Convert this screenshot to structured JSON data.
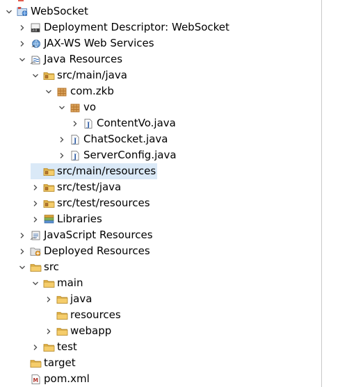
{
  "tree": {
    "rows": [
      {
        "label": "WebSocket",
        "icon": "web-project-icon",
        "toggle": "expanded",
        "level": 0,
        "selected": false,
        "name": "tree-item-websocket"
      },
      {
        "label": "Deployment Descriptor: WebSocket",
        "icon": "deployment-descriptor-icon",
        "toggle": "collapsed",
        "level": 1,
        "selected": false,
        "name": "tree-item-deployment-descriptor"
      },
      {
        "label": "JAX-WS Web Services",
        "icon": "web-services-icon",
        "toggle": "collapsed",
        "level": 1,
        "selected": false,
        "name": "tree-item-jax-ws-web-services"
      },
      {
        "label": "Java Resources",
        "icon": "java-resources-icon",
        "toggle": "expanded",
        "level": 1,
        "selected": false,
        "name": "tree-item-java-resources"
      },
      {
        "label": "src/main/java",
        "icon": "source-folder-icon",
        "toggle": "expanded",
        "level": 2,
        "selected": false,
        "name": "tree-item-src-main-java"
      },
      {
        "label": "com.zkb",
        "icon": "package-icon",
        "toggle": "expanded",
        "level": 3,
        "selected": false,
        "name": "tree-item-com-zkb"
      },
      {
        "label": "vo",
        "icon": "package-icon",
        "toggle": "expanded",
        "level": 4,
        "selected": false,
        "name": "tree-item-vo"
      },
      {
        "label": "ContentVo.java",
        "icon": "java-file-icon",
        "toggle": "collapsed",
        "level": 5,
        "selected": false,
        "name": "tree-item-contentvo-java"
      },
      {
        "label": "ChatSocket.java",
        "icon": "java-file-icon",
        "toggle": "collapsed",
        "level": 4,
        "selected": false,
        "name": "tree-item-chatsocket-java"
      },
      {
        "label": "ServerConfig.java",
        "icon": "java-file-icon",
        "toggle": "collapsed",
        "level": 4,
        "selected": false,
        "name": "tree-item-serverconfig-java"
      },
      {
        "label": "src/main/resources",
        "icon": "source-folder-icon",
        "toggle": "none",
        "level": 2,
        "selected": true,
        "name": "tree-item-src-main-resources"
      },
      {
        "label": "src/test/java",
        "icon": "source-folder-icon",
        "toggle": "collapsed",
        "level": 2,
        "selected": false,
        "name": "tree-item-src-test-java"
      },
      {
        "label": "src/test/resources",
        "icon": "source-folder-icon",
        "toggle": "collapsed",
        "level": 2,
        "selected": false,
        "name": "tree-item-src-test-resources"
      },
      {
        "label": "Libraries",
        "icon": "libraries-icon",
        "toggle": "collapsed",
        "level": 2,
        "selected": false,
        "name": "tree-item-libraries"
      },
      {
        "label": "JavaScript Resources",
        "icon": "javascript-resources-icon",
        "toggle": "collapsed",
        "level": 1,
        "selected": false,
        "name": "tree-item-javascript-resources"
      },
      {
        "label": "Deployed Resources",
        "icon": "deployed-resources-icon",
        "toggle": "collapsed",
        "level": 1,
        "selected": false,
        "name": "tree-item-deployed-resources"
      },
      {
        "label": "src",
        "icon": "folder-icon",
        "toggle": "expanded",
        "level": 1,
        "selected": false,
        "name": "tree-item-src"
      },
      {
        "label": "main",
        "icon": "folder-icon",
        "toggle": "expanded",
        "level": 2,
        "selected": false,
        "name": "tree-item-main"
      },
      {
        "label": "java",
        "icon": "folder-icon",
        "toggle": "collapsed",
        "level": 3,
        "selected": false,
        "name": "tree-item-java"
      },
      {
        "label": "resources",
        "icon": "folder-icon",
        "toggle": "none",
        "level": 3,
        "selected": false,
        "name": "tree-item-resources"
      },
      {
        "label": "webapp",
        "icon": "folder-icon",
        "toggle": "collapsed",
        "level": 3,
        "selected": false,
        "name": "tree-item-webapp"
      },
      {
        "label": "test",
        "icon": "folder-icon",
        "toggle": "collapsed",
        "level": 2,
        "selected": false,
        "name": "tree-item-test"
      },
      {
        "label": "target",
        "icon": "folder-icon",
        "toggle": "none",
        "level": 1,
        "selected": false,
        "name": "tree-item-target"
      },
      {
        "label": "pom.xml",
        "icon": "maven-pom-icon",
        "toggle": "none",
        "level": 1,
        "selected": false,
        "name": "tree-item-pom-xml"
      }
    ]
  },
  "colors": {
    "selection": "#dae9f7",
    "folder": "#e8b64a",
    "package": "#b5742b",
    "java_file": "#2b5aa3",
    "twisty": "#505050"
  }
}
